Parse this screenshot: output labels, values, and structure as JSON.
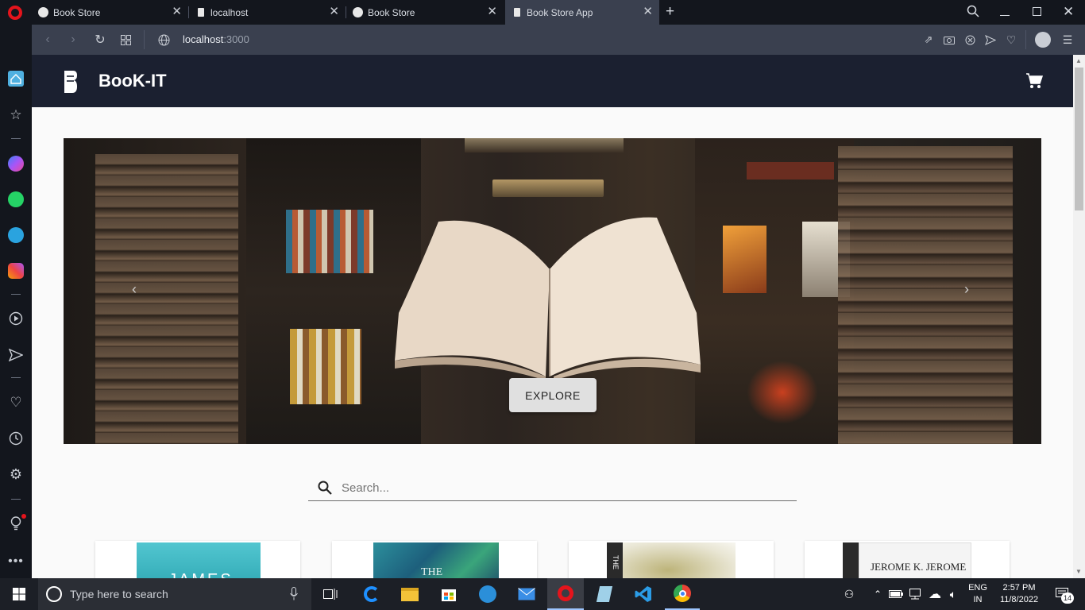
{
  "browser": {
    "tabs": [
      {
        "title": "Book Store",
        "icon": "globe-icon",
        "active": false
      },
      {
        "title": "localhost",
        "icon": "page-icon",
        "active": false
      },
      {
        "title": "Book Store",
        "icon": "globe-icon",
        "active": false
      },
      {
        "title": "Book Store App",
        "icon": "page-icon",
        "active": true
      }
    ],
    "new_tab_label": "+",
    "url_host": "localhost",
    "url_port": ":3000"
  },
  "app": {
    "brand": "BooK-IT",
    "explore_label": "EXPLORE",
    "search_placeholder": "Search...",
    "cards": [
      {
        "title_snippet": "JAMES",
        "color": "#3fb9c4"
      },
      {
        "title_snippet": "THE",
        "color": "#2a7e8f"
      },
      {
        "title_snippet": "THE",
        "color": "#cfc9a3"
      },
      {
        "title_snippet": "JEROME K. JEROME",
        "color": "#f2f2f2"
      }
    ]
  },
  "taskbar": {
    "search_placeholder": "Type here to search",
    "lang_top": "ENG",
    "lang_bottom": "IN",
    "time": "2:57 PM",
    "date": "11/8/2022",
    "notifications": "14"
  },
  "colors": {
    "appbar": "#1b2030",
    "accent_opera": "#e5141c"
  }
}
